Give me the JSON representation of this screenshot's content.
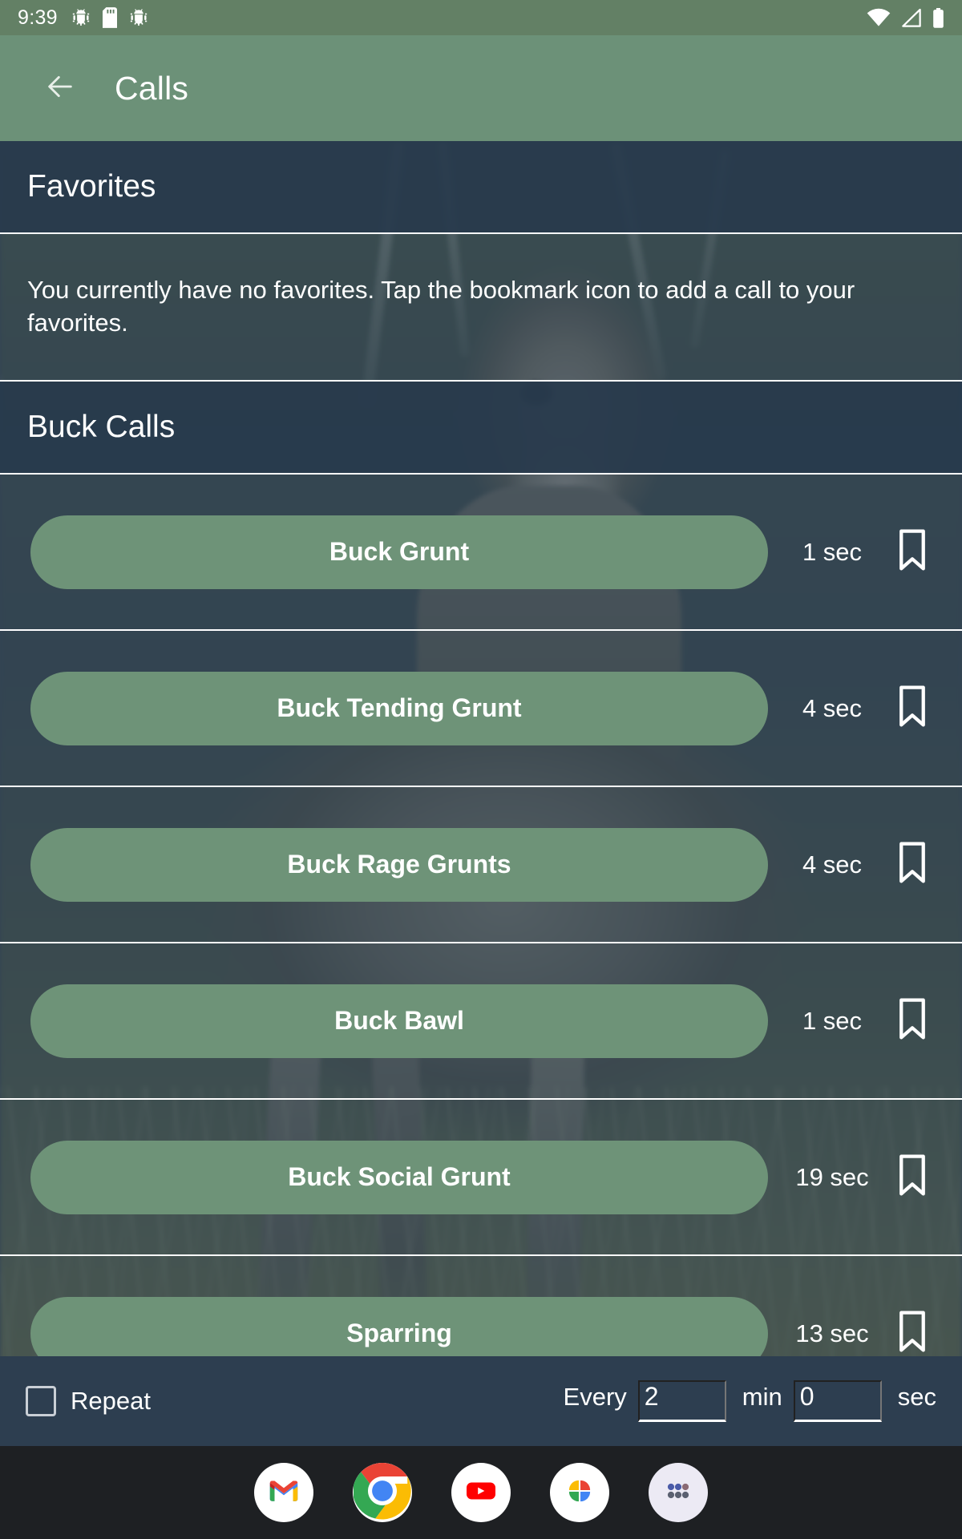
{
  "status_bar": {
    "time": "9:39",
    "left_icons": [
      "android-bug-icon",
      "sd-card-icon",
      "android-bug-icon"
    ],
    "right_icons": [
      "wifi-icon",
      "cell-signal-icon",
      "battery-icon"
    ]
  },
  "app_bar": {
    "back_icon": "back-arrow-icon",
    "title": "Calls",
    "background_color": "#6c9178"
  },
  "favorites": {
    "header": "Favorites",
    "empty_message": "You currently have no favorites. Tap the bookmark icon to add a call to your favorites."
  },
  "buck_calls": {
    "header": "Buck Calls",
    "items": [
      {
        "name": "Buck Grunt",
        "duration": "1 sec",
        "bookmark_icon": "bookmark-outline-icon",
        "bookmarked": false
      },
      {
        "name": "Buck Tending Grunt",
        "duration": "4 sec",
        "bookmark_icon": "bookmark-outline-icon",
        "bookmarked": false
      },
      {
        "name": "Buck Rage Grunts",
        "duration": "4 sec",
        "bookmark_icon": "bookmark-outline-icon",
        "bookmarked": false
      },
      {
        "name": "Buck Bawl",
        "duration": "1 sec",
        "bookmark_icon": "bookmark-outline-icon",
        "bookmarked": false
      },
      {
        "name": "Buck Social Grunt",
        "duration": "19 sec",
        "bookmark_icon": "bookmark-outline-icon",
        "bookmarked": false
      },
      {
        "name": "Sparring",
        "duration": "13 sec",
        "bookmark_icon": "bookmark-outline-icon",
        "bookmarked": false
      }
    ]
  },
  "repeat_bar": {
    "checkbox_checked": false,
    "repeat_label": "Repeat",
    "every_label": "Every",
    "minutes_value": "2",
    "minutes_unit": "min",
    "seconds_value": "0",
    "seconds_unit": "sec",
    "background_color": "#2d3e50"
  },
  "dock": {
    "apps": [
      {
        "name": "Gmail",
        "icon": "gmail-icon"
      },
      {
        "name": "Chrome",
        "icon": "chrome-icon"
      },
      {
        "name": "YouTube",
        "icon": "youtube-icon"
      },
      {
        "name": "Google Photos",
        "icon": "google-photos-icon"
      },
      {
        "name": "App Drawer",
        "icon": "app-drawer-icon"
      }
    ]
  },
  "theme": {
    "accent_green": "#6e9378",
    "header_blue": "#2d3e50",
    "text_white": "#ffffff"
  }
}
